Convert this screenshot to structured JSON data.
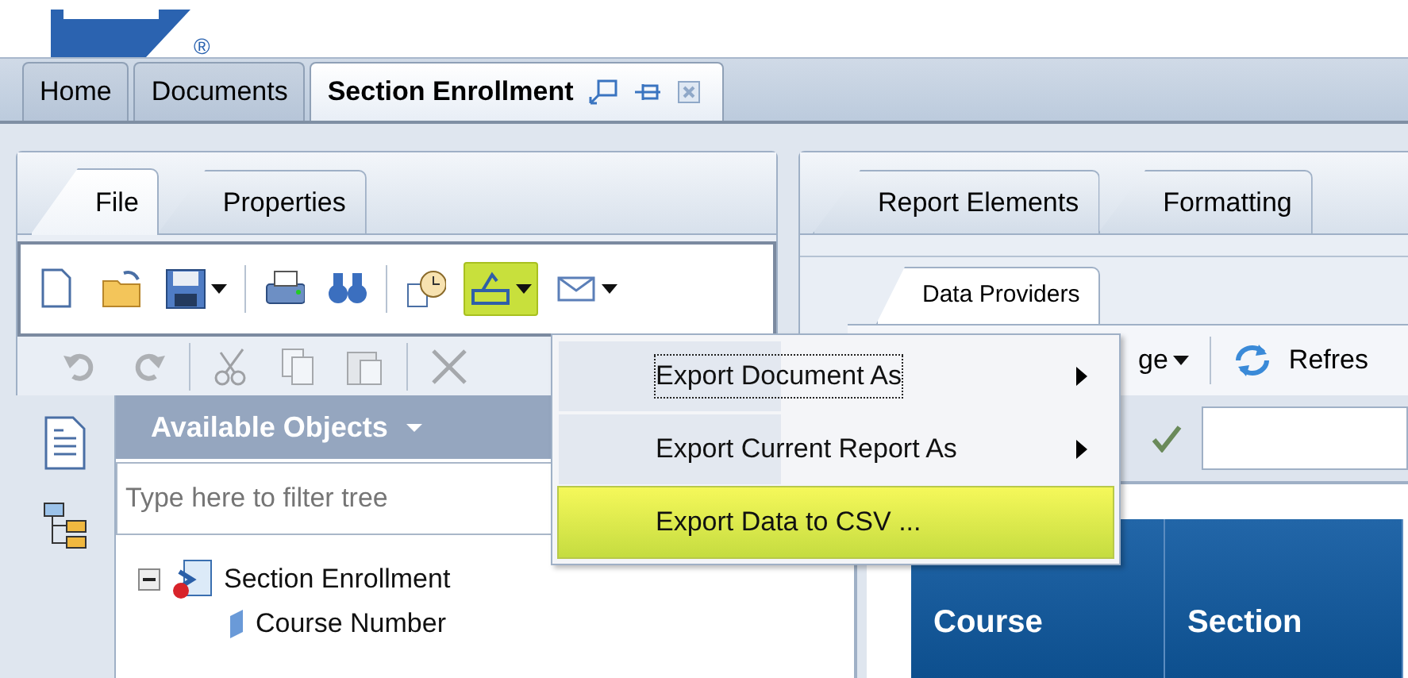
{
  "logo": {
    "mark": "®"
  },
  "doc_tabs": [
    {
      "label": "Home",
      "selected": false
    },
    {
      "label": "Documents",
      "selected": false
    },
    {
      "label": "Section Enrollment",
      "selected": true
    }
  ],
  "left_tabs": [
    {
      "label": "File",
      "selected": true
    },
    {
      "label": "Properties",
      "selected": false
    }
  ],
  "file_toolbar": [
    {
      "kind": "new",
      "highlighted": false,
      "menu": false
    },
    {
      "kind": "open",
      "highlighted": false,
      "menu": false
    },
    {
      "kind": "save",
      "highlighted": false,
      "menu": true
    },
    {
      "kind": "sep"
    },
    {
      "kind": "print",
      "highlighted": false,
      "menu": false
    },
    {
      "kind": "find",
      "highlighted": false,
      "menu": false
    },
    {
      "kind": "sep"
    },
    {
      "kind": "schedule",
      "highlighted": false,
      "menu": false
    },
    {
      "kind": "export",
      "highlighted": true,
      "menu": true
    },
    {
      "kind": "mail",
      "highlighted": false,
      "menu": true
    }
  ],
  "edit_toolbar": [
    {
      "kind": "undo",
      "disabled": true
    },
    {
      "kind": "redo",
      "disabled": true
    },
    {
      "kind": "sep"
    },
    {
      "kind": "cut",
      "disabled": true
    },
    {
      "kind": "copy",
      "disabled": true
    },
    {
      "kind": "paste",
      "disabled": true
    },
    {
      "kind": "sep"
    },
    {
      "kind": "delete",
      "disabled": true
    }
  ],
  "available_objects": {
    "title": "Available Objects",
    "filter_placeholder": "Type here to filter tree",
    "tree": [
      {
        "label": "Section Enrollment",
        "expanded": true,
        "children": [
          {
            "label": "Course Number"
          }
        ]
      }
    ]
  },
  "right_tabs": [
    {
      "label": "Report Elements",
      "selected": false
    },
    {
      "label": "Formatting",
      "selected": false
    }
  ],
  "sub_tabs": [
    {
      "label": "Data Providers",
      "selected": true
    }
  ],
  "report_toolbar": {
    "page_label": "ge",
    "refresh_label": "Refres"
  },
  "table": {
    "columns": [
      "Course",
      "Section"
    ]
  },
  "export_menu": [
    {
      "label": "Export Document As",
      "submenu": true,
      "focused": true,
      "selected": false
    },
    {
      "label": "Export Current Report As",
      "submenu": true,
      "focused": false,
      "selected": false
    },
    {
      "label": "Export Data to CSV ...",
      "submenu": false,
      "focused": false,
      "selected": true
    }
  ]
}
